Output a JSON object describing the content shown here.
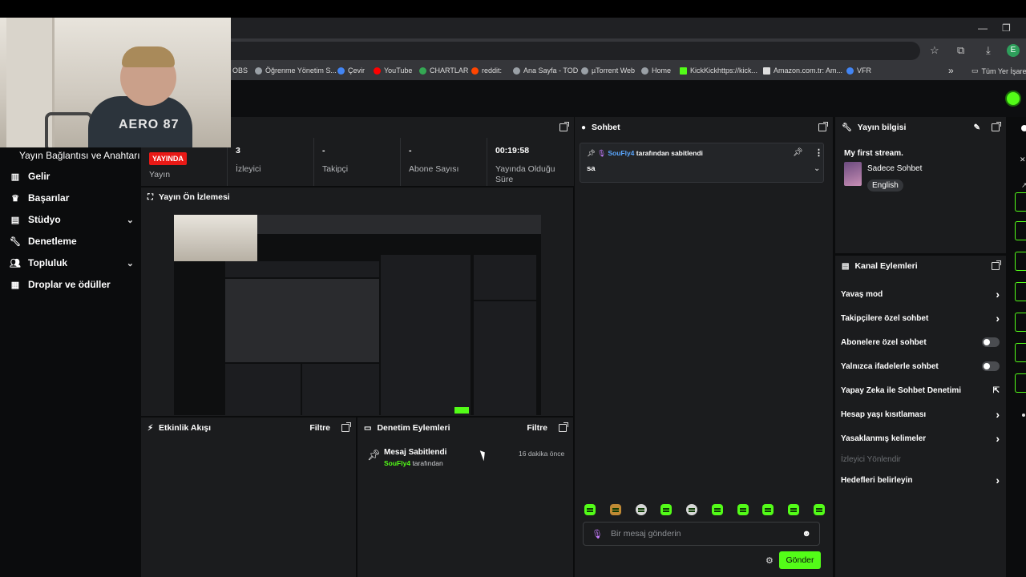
{
  "browser": {
    "bookmarks": [
      {
        "label": "OBS"
      },
      {
        "label": "Öğrenme Yönetim S..."
      },
      {
        "label": "Çevir"
      },
      {
        "label": "YouTube"
      },
      {
        "label": "CHARTLAR"
      },
      {
        "label": "reddit:"
      },
      {
        "label": "Ana Sayfa - TOD"
      },
      {
        "label": "µTorrent Web"
      },
      {
        "label": "Home"
      },
      {
        "label": "KickKickhttps://kick..."
      },
      {
        "label": "Amazon.com.tr: Am..."
      },
      {
        "label": "VFR"
      }
    ],
    "bookmarks_overflow": "»",
    "all_bookmarks": "Tüm Yer İşaret",
    "profile_initial": "E",
    "webcam_shirt_text": "AERO 87"
  },
  "nav": {
    "title": "Yayın Bağlantısı ve Anahtarı",
    "items": [
      {
        "label": "Gelir",
        "icon": "chart-icon"
      },
      {
        "label": "Başarılar",
        "icon": "trophy-icon"
      },
      {
        "label": "Stüdyo",
        "icon": "studio-icon",
        "expandable": true
      },
      {
        "label": "Denetleme",
        "icon": "wrench-icon"
      },
      {
        "label": "Topluluk",
        "icon": "people-icon",
        "expandable": true
      },
      {
        "label": "Droplar ve ödüller",
        "icon": "gift-icon"
      }
    ]
  },
  "stats": {
    "live_badge": "YAYINDA",
    "live_label": "Yayın",
    "items": [
      {
        "value": "3",
        "label": "İzleyici"
      },
      {
        "value": "-",
        "label": "Takipçi"
      },
      {
        "value": "-",
        "label": "Abone Sayısı"
      },
      {
        "value": "00:19:58",
        "label": "Yayında Olduğu Süre"
      }
    ]
  },
  "preview": {
    "title": "Yayın Ön İzlemesi"
  },
  "activity": {
    "title": "Etkinlik Akışı",
    "filter": "Filtre"
  },
  "moderation": {
    "title": "Denetim Eylemleri",
    "filter": "Filtre",
    "entry": {
      "title": "Mesaj Sabitlendi",
      "user": "SouFly4",
      "by": "tarafından",
      "time": "16 dakika önce"
    }
  },
  "chat": {
    "title": "Sohbet",
    "pinned": {
      "user": "SouFly4",
      "suffix": "tarafından sabitlendi",
      "message": "sa"
    },
    "input_placeholder": "Bir mesaj gönderin",
    "send": "Gönder"
  },
  "stream_info": {
    "title": "Yayın bilgisi",
    "stream_title": "My first stream.",
    "category": "Sadece Sohbet",
    "tag": "English"
  },
  "channel_actions": {
    "title": "Kanal Eylemleri",
    "items": [
      {
        "label": "Yavaş mod",
        "control": "chevron"
      },
      {
        "label": "Takipçilere özel sohbet",
        "control": "chevron"
      },
      {
        "label": "Abonelere özel sohbet",
        "control": "toggle"
      },
      {
        "label": "Yalnızca ifadelerle sohbet",
        "control": "toggle"
      },
      {
        "label": "Yapay Zeka ile Sohbet Denetimi",
        "control": "external"
      },
      {
        "label": "Hesap yaşı kısıtlaması",
        "control": "chevron"
      },
      {
        "label": "Yasaklanmış kelimeler",
        "control": "chevron"
      }
    ],
    "section_label": "İzleyici Yönlendir",
    "goals": "Hedefleri belirleyin"
  },
  "colors": {
    "accent": "#53fc18",
    "live": "#e91916",
    "panel": "#1b1c1e",
    "background": "#0b0c0d"
  }
}
